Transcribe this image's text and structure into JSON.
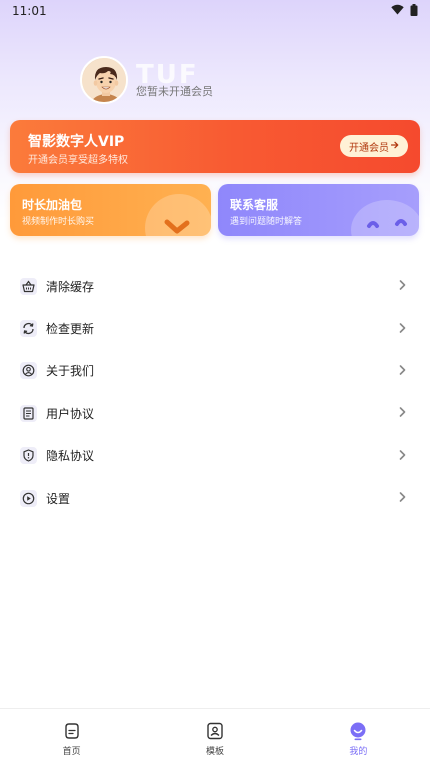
{
  "status_bar": {
    "time": "11:01",
    "icons": [
      "wifi-icon",
      "battery-icon"
    ]
  },
  "profile": {
    "avatar": "cartoon-avatar",
    "watermark": "TUF",
    "status": "您暂未开通会员"
  },
  "vip": {
    "title": "智影数字人VIP",
    "subtitle": "开通会员享受超多特权",
    "button": "开通会员"
  },
  "cards": [
    {
      "title": "时长加油包",
      "subtitle": "视频制作时长购买",
      "color": "#ffa548"
    },
    {
      "title": "联系客服",
      "subtitle": "遇到问题随时解答",
      "color": "#9990fb"
    }
  ],
  "menu": [
    {
      "label": "清除缓存",
      "icon": "basket-icon"
    },
    {
      "label": "检查更新",
      "icon": "refresh-icon"
    },
    {
      "label": "关于我们",
      "icon": "user-circle-icon"
    },
    {
      "label": "用户协议",
      "icon": "document-icon"
    },
    {
      "label": "隐私协议",
      "icon": "shield-icon"
    },
    {
      "label": "设置",
      "icon": "settings-icon"
    }
  ],
  "tabs": [
    {
      "label": "首页",
      "icon": "home-icon",
      "active": false
    },
    {
      "label": "模板",
      "icon": "template-icon",
      "active": false
    },
    {
      "label": "我的",
      "icon": "profile-face-icon",
      "active": true
    }
  ],
  "colors": {
    "accent": "#7b6ef6",
    "vip_orange": "#f85a32",
    "card_orange": "#ffa548",
    "card_purple": "#9990fb"
  }
}
